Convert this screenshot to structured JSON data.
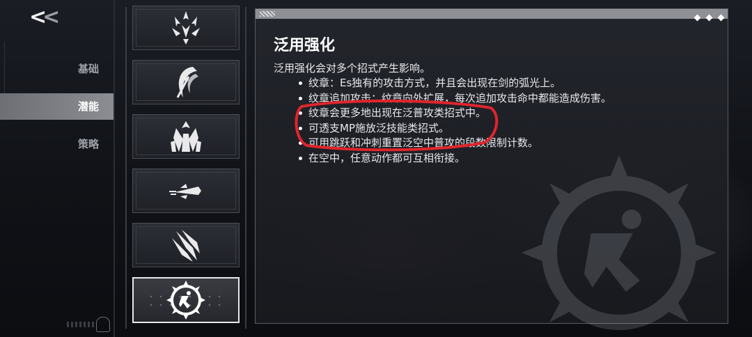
{
  "nav": {
    "back_label": "<<",
    "tabs": [
      {
        "label": "基础",
        "active": false
      },
      {
        "label": "潜能",
        "active": true
      },
      {
        "label": "策略",
        "active": false
      }
    ]
  },
  "skills": {
    "icons": [
      "arrow-burst-icon",
      "crescent-blade-icon",
      "crystal-burst-icon",
      "dart-streak-icon",
      "claw-slash-icon",
      "running-figure-emblem-icon"
    ],
    "selected_index": 5
  },
  "detail": {
    "title": "泛用强化",
    "intro": "泛用强化会对多个招式产生影响。",
    "bullets": [
      "纹章：Es独有的攻击方式，并且会出现在剑的弧光上。",
      "纹章追加攻击：纹章向外扩展，每次追加攻击命中都能造成伤害。",
      "纹章会更多地出现在泛普攻类招式中。",
      "可透支MP施放泛技能类招式。",
      "可用跳跃和冲刺重置泛空中普攻的段数限制计数。",
      "在空中，任意动作都可互相衔接。"
    ]
  },
  "colors": {
    "accent_active_tab": "#7c7e83",
    "annotation_red": "#e0252c",
    "panel_bar": "#8e9096"
  }
}
